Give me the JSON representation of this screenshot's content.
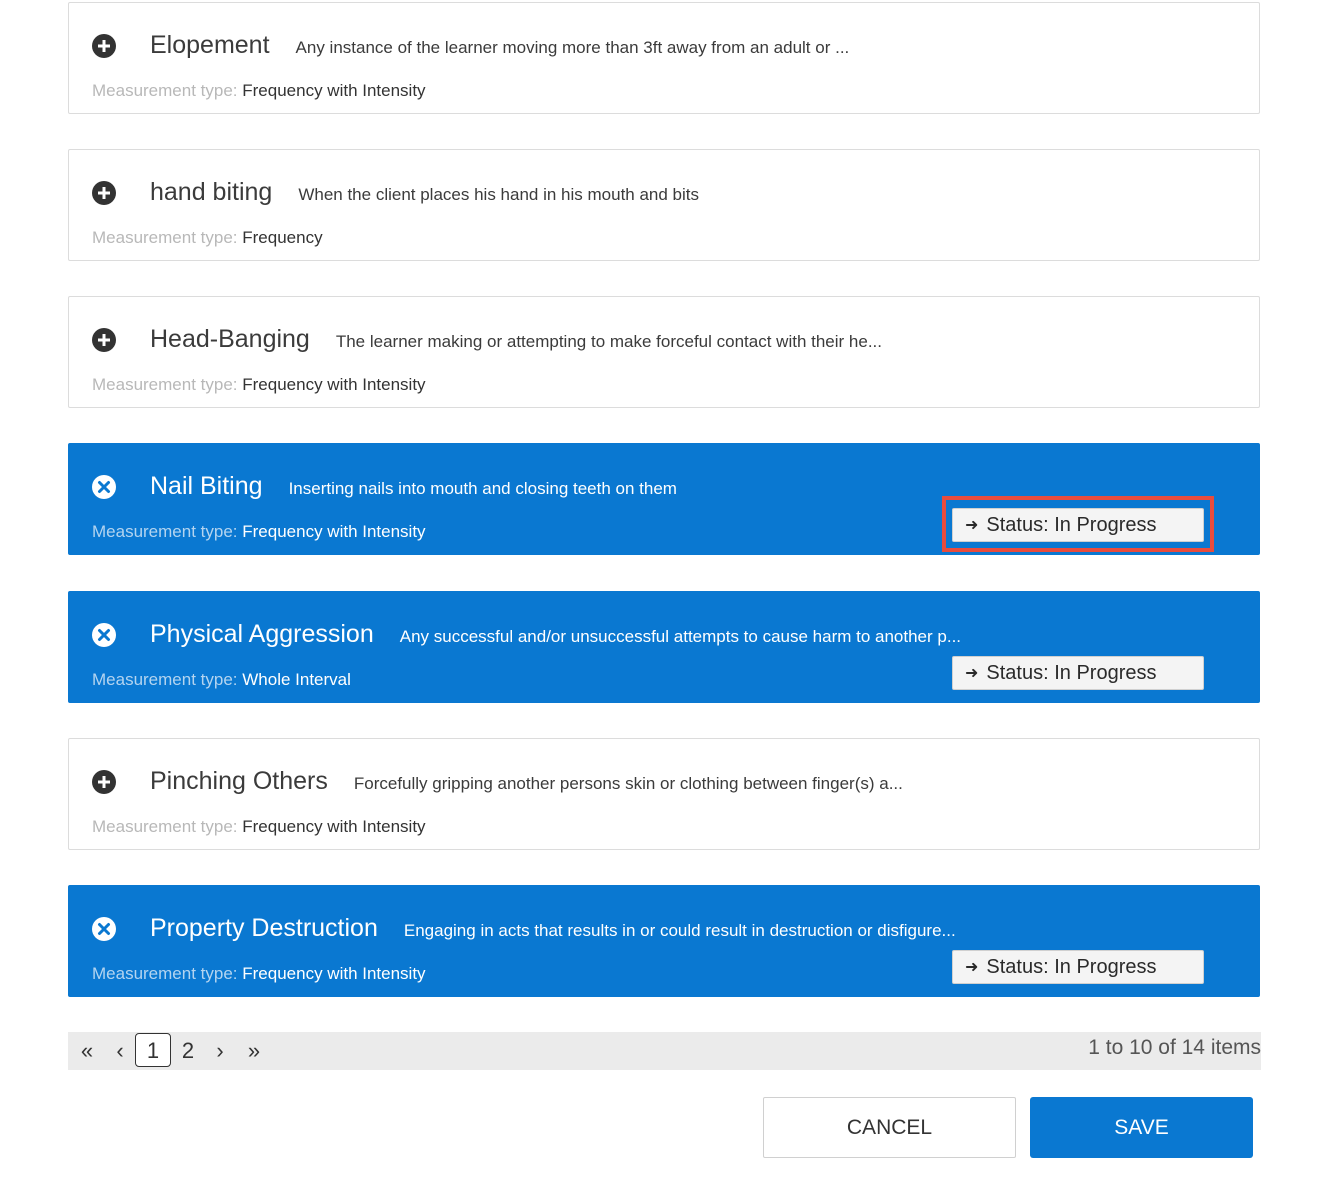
{
  "measurement_label": "Measurement type:",
  "behaviors": [
    {
      "title": "Elopement",
      "description": "Any instance of the learner moving more than 3ft away from an adult or ...",
      "measurement_type": "Frequency with Intensity",
      "selected": false,
      "icon": "plus-circle-icon"
    },
    {
      "title": "hand biting",
      "description": "When the client places his hand in his mouth and bits",
      "measurement_type": "Frequency",
      "selected": false,
      "icon": "plus-circle-icon"
    },
    {
      "title": "Head-Banging",
      "description": "The learner making or attempting to make forceful contact with their he...",
      "measurement_type": "Frequency with Intensity",
      "selected": false,
      "icon": "plus-circle-icon"
    },
    {
      "title": "Nail Biting",
      "description": "Inserting nails into mouth and closing teeth on them",
      "measurement_type": "Frequency with Intensity",
      "selected": true,
      "icon": "x-circle-icon",
      "status": "Status: In Progress"
    },
    {
      "title": "Physical Aggression",
      "description": "Any successful and/or unsuccessful attempts to cause harm to another p...",
      "measurement_type": "Whole Interval",
      "selected": true,
      "icon": "x-circle-icon",
      "status": "Status: In Progress"
    },
    {
      "title": "Pinching Others",
      "description": "Forcefully gripping another persons skin or clothing between finger(s) a...",
      "measurement_type": "Frequency with Intensity",
      "selected": false,
      "icon": "plus-circle-icon"
    },
    {
      "title": "Property Destruction",
      "description": "Engaging in acts that results in or could result in destruction or disfigure...",
      "measurement_type": "Frequency with Intensity",
      "selected": true,
      "icon": "x-circle-icon",
      "status": "Status: In Progress"
    }
  ],
  "pagination": {
    "first": "«",
    "prev": "‹",
    "pages": [
      "1",
      "2"
    ],
    "current_page": "1",
    "next": "›",
    "last": "»",
    "info": "1 to 10 of 14 items"
  },
  "actions": {
    "cancel": "CANCEL",
    "save": "SAVE"
  },
  "colors": {
    "selected_bg": "#0a78d1",
    "highlight_border": "#e84c3d",
    "save_bg": "#0a78d1"
  }
}
